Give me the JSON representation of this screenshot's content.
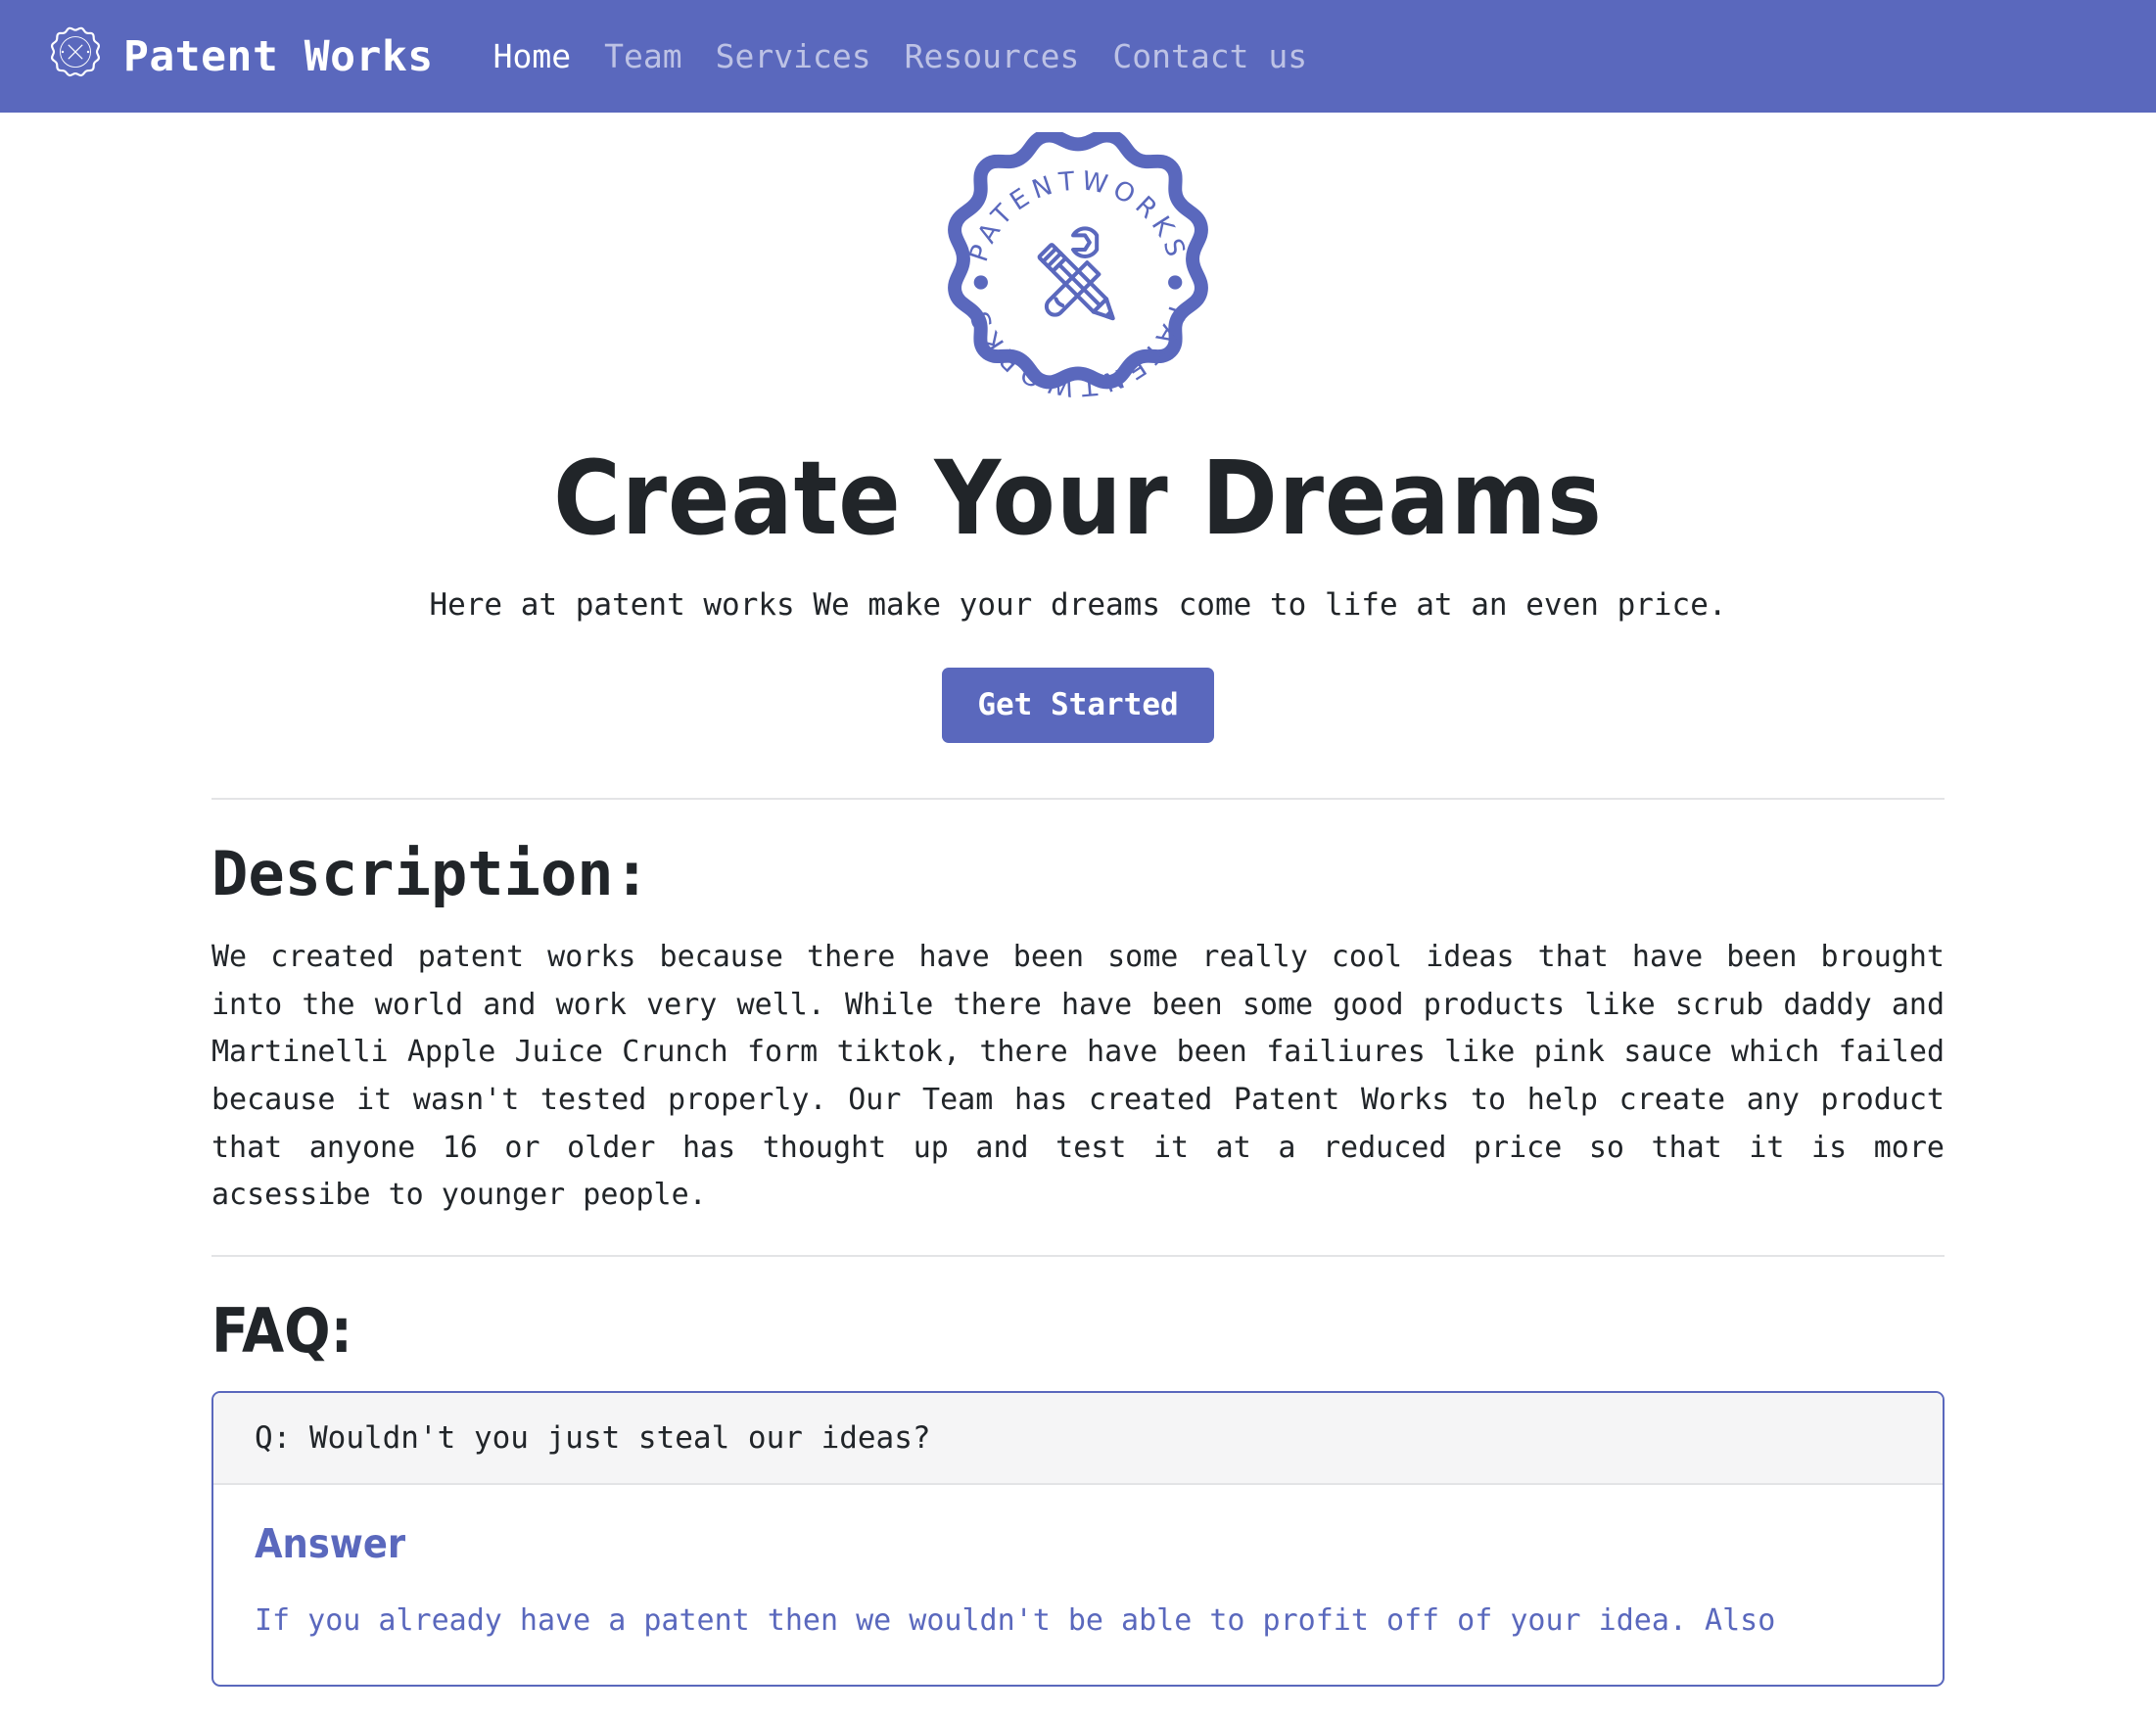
{
  "theme": {
    "brand_color": "#5a68bd",
    "text_color": "#212529",
    "muted_nav_color": "rgba(255,255,255,0.6)",
    "card_header_bg": "#f5f5f6",
    "divider_color": "#e3e4e6"
  },
  "navbar": {
    "brand_name": "Patent Works",
    "logo_icon": "patentworks-badge-icon",
    "links": [
      {
        "label": "Home",
        "active": true
      },
      {
        "label": "Team",
        "active": false
      },
      {
        "label": "Services",
        "active": false
      },
      {
        "label": "Resources",
        "active": false
      },
      {
        "label": "Contact us",
        "active": false
      }
    ]
  },
  "hero": {
    "logo_icon": "patentworks-badge-icon",
    "logo_text_top": "PATENTWORKS",
    "logo_text_bottom": "PATENTWORKS",
    "title": "Create Your Dreams",
    "subtitle": "Here at patent works We make your dreams come to life at an even price.",
    "cta_label": "Get Started"
  },
  "description": {
    "heading": "Description:",
    "body": "We created patent works because there have been some really cool ideas that have been brought into the world and work very well. While there have been some good products like scrub daddy and Martinelli Apple Juice Crunch form tiktok, there have been failiures like pink sauce which failed because it wasn't tested properly. Our Team has created Patent Works to help create any product that anyone 16 or older has thought up and test it at a reduced price so that it is more acsessibe to younger people."
  },
  "faq": {
    "heading": "FAQ:",
    "items": [
      {
        "question": "Q: Wouldn't you just steal our ideas?",
        "answer_title": "Answer",
        "answer_text": "If you already have a patent then we wouldn't be able to profit off of your idea. Also"
      }
    ]
  }
}
